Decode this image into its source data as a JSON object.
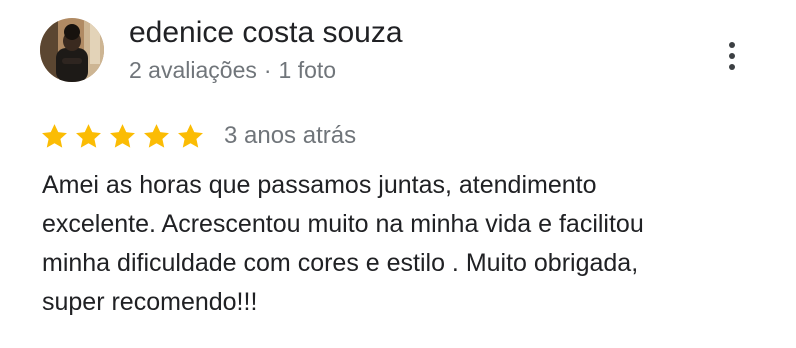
{
  "author": {
    "name": "edenice costa souza",
    "review_count": "2 avaliações",
    "separator": "·",
    "photo_count": "1 foto"
  },
  "menu": {
    "icon": "more-vert-icon"
  },
  "rating": {
    "stars": 5,
    "max": 5,
    "star_color": "#fbbc04",
    "date": "3 anos atrás"
  },
  "review": {
    "lines": [
      "Amei as horas que passamos juntas, atendimento",
      "excelente. Acrescentou muito na minha vida e facilitou",
      "minha dificuldade com cores e estilo . Muito obrigada,",
      "super recomendo!!!"
    ]
  }
}
